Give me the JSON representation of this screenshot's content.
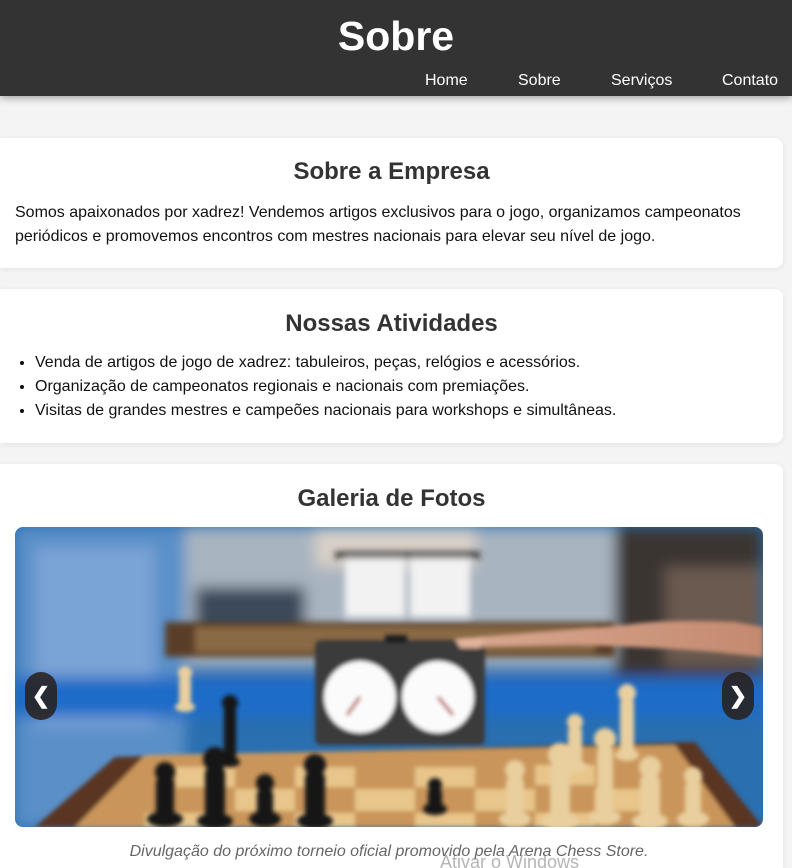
{
  "header": {
    "title": "Sobre",
    "nav": [
      "Home",
      "Sobre",
      "Serviços",
      "Contato"
    ]
  },
  "about": {
    "heading": "Sobre a Empresa",
    "text": "Somos apaixonados por xadrez! Vendemos artigos exclusivos para o jogo, organizamos campeonatos periódicos e promovemos encontros com mestres nacionais para elevar seu nível de jogo."
  },
  "activities": {
    "heading": "Nossas Atividades",
    "items": [
      "Venda de artigos de jogo de xadrez: tabuleiros, peças, relógios e acessórios.",
      "Organização de campeonatos regionais e nacionais com premiações.",
      "Visitas de grandes mestres e campeões nacionais para workshops e simultâneas."
    ]
  },
  "gallery": {
    "heading": "Galeria de Fotos",
    "prev_label": "❮",
    "next_label": "❯",
    "caption": "Divulgação do próximo torneio oficial promovido pela Arena Chess Store."
  },
  "watermark": "Ativar o Windows",
  "icons": {
    "prev": "chevron-left-icon",
    "next": "chevron-right-icon"
  },
  "colors": {
    "header_bg": "#333333",
    "page_bg": "#f4f4f4",
    "card_bg": "#ffffff"
  }
}
